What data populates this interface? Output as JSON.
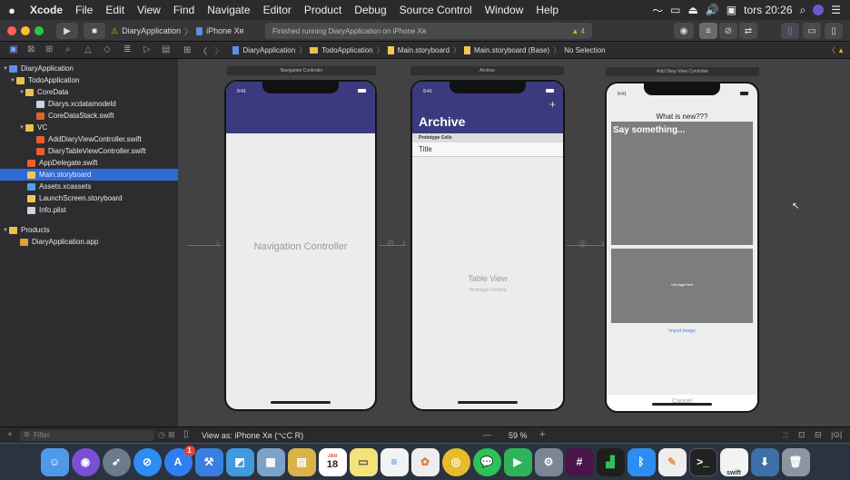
{
  "menubar": {
    "apple": "",
    "items": [
      "Xcode",
      "File",
      "Edit",
      "View",
      "Find",
      "Navigate",
      "Editor",
      "Product",
      "Debug",
      "Source Control",
      "Window",
      "Help"
    ],
    "clock": "tors 20:26"
  },
  "toolbar": {
    "scheme": "DiaryApplication",
    "device": "iPhone Xʀ",
    "activity": "Finished running DiaryApplication on iPhone Xʀ",
    "warnings": "4"
  },
  "sidebar": {
    "items": [
      {
        "label": "DiaryApplication",
        "indent": 0,
        "icon": "proj",
        "tri": "▼"
      },
      {
        "label": "TodoApplication",
        "indent": 1,
        "icon": "folder",
        "tri": "▼"
      },
      {
        "label": "CoreData",
        "indent": 2,
        "icon": "folder",
        "tri": "▼"
      },
      {
        "label": "Diarys.xcdatamodeld",
        "indent": 3,
        "icon": "doc",
        "tri": ""
      },
      {
        "label": "CoreDataStack.swift",
        "indent": 3,
        "icon": "swift",
        "tri": ""
      },
      {
        "label": "VC",
        "indent": 2,
        "icon": "folder",
        "tri": "▼"
      },
      {
        "label": "AddDiaryViewController.swift",
        "indent": 3,
        "icon": "swift",
        "tri": ""
      },
      {
        "label": "DiaryTableViewController.swift",
        "indent": 3,
        "icon": "swift",
        "tri": ""
      },
      {
        "label": "AppDelegate.swift",
        "indent": 2,
        "icon": "swift",
        "tri": ""
      },
      {
        "label": "Main.storyboard",
        "indent": 2,
        "icon": "sb",
        "tri": "",
        "selected": true
      },
      {
        "label": "Assets.xcassets",
        "indent": 2,
        "icon": "folder",
        "tri": ""
      },
      {
        "label": "LaunchScreen.storyboard",
        "indent": 2,
        "icon": "sb",
        "tri": ""
      },
      {
        "label": "Info.plist",
        "indent": 2,
        "icon": "doc",
        "tri": ""
      },
      {
        "label": "Products",
        "indent": 1,
        "icon": "folder",
        "tri": "▼"
      },
      {
        "label": "DiaryApplication.app",
        "indent": 2,
        "icon": "app",
        "tri": ""
      }
    ],
    "filter_placeholder": "Filter"
  },
  "jumpbar": {
    "crumbs": [
      "DiaryApplication",
      "TodoApplication",
      "Main.storyboard",
      "Main.storyboard (Base)",
      "No Selection"
    ]
  },
  "scenes": {
    "nav": {
      "title": "Navigation Controller",
      "label": "Navigation Controller",
      "time": "9:41"
    },
    "archive": {
      "title": "Archive",
      "time": "9:41",
      "large_title": "Archive",
      "plus": "+",
      "section": "Prototype Cells",
      "cell": "Title",
      "table_title": "Table View",
      "table_sub": "Prototype Content"
    },
    "add": {
      "title": "Add Diary View Controller",
      "time": "9:41",
      "heading": "What is new???",
      "text": "Say something...",
      "image_label": "UIImageView",
      "import": "Import Image",
      "cancel": "Cancel"
    }
  },
  "bottombar": {
    "view_as": "View as: iPhone Xʀ (",
    "view_as_suffix": "C  R)",
    "zoom": "59 %",
    "minus": "—",
    "plus": "+"
  },
  "colors": {
    "nav_bar": "#3b3a7e",
    "selected": "#2f6bd6",
    "link": "#3b82f6"
  },
  "dock": {
    "calendar_day": "18",
    "calendar_month": "JAN",
    "swift_label": "swift",
    "appstore_badge": "1"
  }
}
